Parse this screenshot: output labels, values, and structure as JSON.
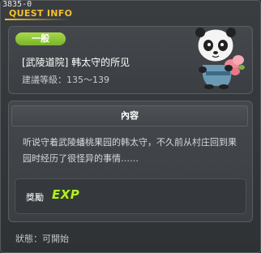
{
  "window": {
    "quest_id": "3835-0",
    "title": "QUEST INFO"
  },
  "quest": {
    "badge": "一般",
    "name": "[武陵道院] 韩太守的所见",
    "level": "建議等級：135～139"
  },
  "content": {
    "header": "內容",
    "description": "听说守着武陵蟠桃果园的韩太守，不久前从村庄回到果园时经历了很怪异的事情……"
  },
  "reward": {
    "label": "獎勵",
    "exp_text": "EXP"
  },
  "status": {
    "text": "狀態：可開始"
  },
  "colors": {
    "title": "#f3c12a",
    "badge": "#8cc63a",
    "exp": "#b6ec2e"
  }
}
